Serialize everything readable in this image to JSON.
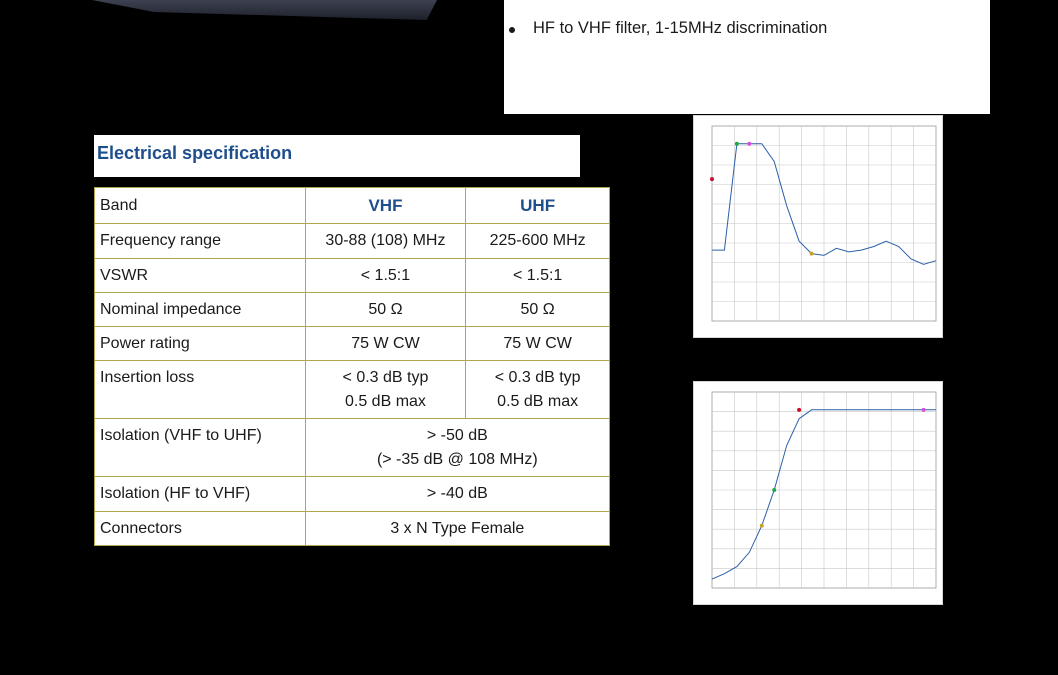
{
  "bullets": [
    "HF to VHF filter, 1-15MHz discrimination"
  ],
  "spec_title": "Electrical specification",
  "table": {
    "header": {
      "band": "Band",
      "vhf": "VHF",
      "uhf": "UHF"
    },
    "rows": [
      {
        "label": "Frequency range",
        "vhf": "30-88 (108) MHz",
        "uhf": "225-600 MHz"
      },
      {
        "label": "VSWR",
        "vhf": "< 1.5:1",
        "uhf": "< 1.5:1"
      },
      {
        "label": "Nominal impedance",
        "vhf": "50 Ω",
        "uhf": "50 Ω"
      },
      {
        "label": "Power rating",
        "vhf": "75 W CW",
        "uhf": "75 W CW"
      },
      {
        "label": "Insertion loss",
        "vhf_line1": "< 0.3 dB typ",
        "vhf_line2": "0.5 dB max",
        "uhf_line1": "< 0.3 dB typ",
        "uhf_line2": "0.5 dB max"
      },
      {
        "label": "Isolation (VHF to UHF)",
        "both_line1": "> -50 dB",
        "both_line2": "(> -35 dB @ 108 MHz)"
      },
      {
        "label": "Isolation (HF to VHF)",
        "both": "> -40 dB"
      },
      {
        "label": "Connectors",
        "both": "3 x N Type Female"
      }
    ]
  },
  "colors": {
    "heading_blue": "#1f4e8c",
    "table_border": "#b2a64a",
    "trace_blue": "#2d5fa8"
  },
  "chart_data": [
    {
      "type": "line",
      "series": [
        {
          "values": [
            -60,
            -60,
            0,
            0,
            0,
            -10,
            -35,
            -55,
            -62,
            -63,
            -59,
            -61,
            -60,
            -58,
            -55,
            -58,
            -65,
            -68,
            -66
          ]
        }
      ],
      "markers": [
        "green",
        "red",
        "magenta",
        "yellow"
      ],
      "grid": true
    },
    {
      "type": "line",
      "series": [
        {
          "values": [
            -95,
            -92,
            -88,
            -80,
            -65,
            -45,
            -20,
            -5,
            0,
            0,
            0,
            0,
            0,
            0,
            0,
            0,
            0,
            0,
            0
          ]
        }
      ],
      "markers": [
        "green",
        "red",
        "magenta",
        "yellow"
      ],
      "grid": true
    }
  ]
}
